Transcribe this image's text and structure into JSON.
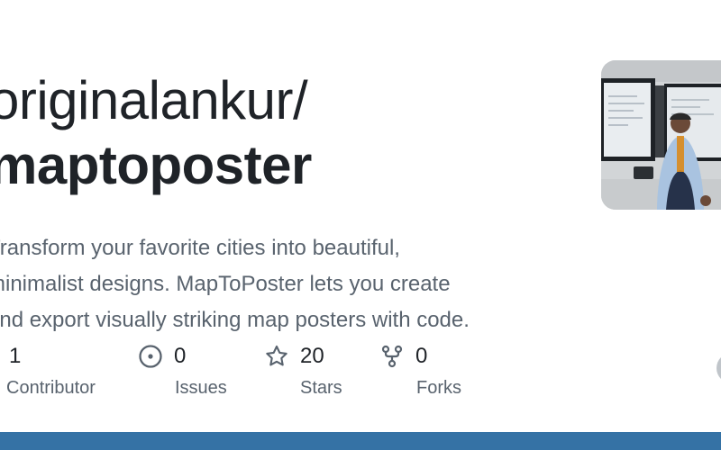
{
  "repo": {
    "owner": "originalankur/",
    "name": "maptoposter",
    "description_lines": [
      "Transform your favorite cities into beautiful,",
      "minimalist designs. MapToPoster lets you create",
      "and export visually striking map posters with code."
    ]
  },
  "stats": {
    "contributors": {
      "value": "1",
      "label": "Contributor",
      "icon": "people-icon"
    },
    "issues": {
      "value": "0",
      "label": "Issues",
      "icon": "issue-opened-icon"
    },
    "stars": {
      "value": "20",
      "label": "Stars",
      "icon": "star-icon"
    },
    "forks": {
      "value": "0",
      "label": "Forks",
      "icon": "repo-forked-icon"
    }
  },
  "colors": {
    "language_bar": "#3572a5",
    "text_primary": "#1f2328",
    "text_muted": "#59636e"
  }
}
